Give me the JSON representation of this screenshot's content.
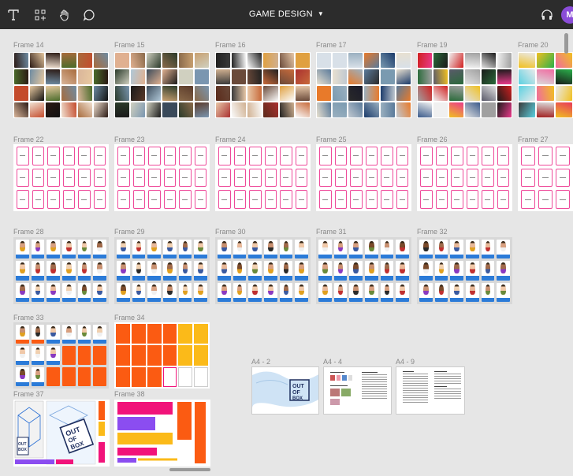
{
  "toolbar": {
    "title": "GAME DESIGN",
    "avatar_initial": "M",
    "tools": [
      {
        "name": "text-tool-icon",
        "glyph": "T"
      },
      {
        "name": "components-icon",
        "glyph": "⁘"
      },
      {
        "name": "hand-tool-icon",
        "glyph": "✋"
      },
      {
        "name": "comment-icon",
        "glyph": "◯"
      }
    ],
    "audio_icon": "headphones-icon"
  },
  "frames": {
    "f14": "Frame 14",
    "f15": "Frame 15",
    "f16": "Frame 16",
    "f17": "Frame 17",
    "f19": "Frame 19",
    "f20": "Frame 20",
    "f22": "Frame 22",
    "f23": "Frame 23",
    "f24": "Frame 24",
    "f25": "Frame 25",
    "f26": "Frame 26",
    "f27": "Frame 27",
    "f28": "Frame 28",
    "f29": "Frame 29",
    "f30": "Frame 30",
    "f31": "Frame 31",
    "f32": "Frame 32",
    "f33": "Frame 33",
    "f34": "Frame 34",
    "f37": "Frame 37",
    "f38": "Frame 38",
    "a42": "A4 - 2",
    "a44": "A4 - 4",
    "a49": "A4 - 9"
  },
  "colors": {
    "toolbar": "#2c2c2c",
    "canvas": "#e6e6e6",
    "card_border": "#ee4a9a",
    "card_bar": "#2b7bd8",
    "orange": "#fb5b12",
    "yellow": "#fbba19",
    "magenta": "#f1137a",
    "purple": "#8b4df0",
    "avatar": "#8a4cd8"
  }
}
